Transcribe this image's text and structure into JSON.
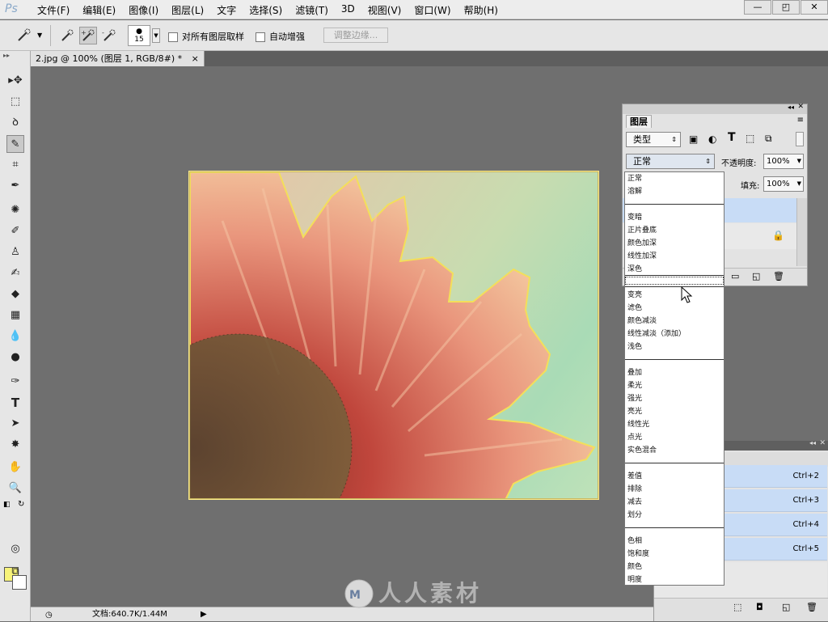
{
  "app": {
    "logo": "Ps",
    "menus": [
      "文件(F)",
      "编辑(E)",
      "图像(I)",
      "图层(L)",
      "文字",
      "选择(S)",
      "滤镜(T)",
      "3D",
      "视图(V)",
      "窗口(W)",
      "帮助(H)"
    ],
    "window_controls": [
      "—",
      "◰",
      "✕"
    ]
  },
  "options": {
    "brush_size": "15",
    "sample_all_label": "对所有图层取样",
    "auto_enhance_label": "自动增强",
    "refine_edge_label": "调整边缘..."
  },
  "document": {
    "tab_title": "2.jpg @ 100% (图层 1, RGB/8#) *",
    "close": "×",
    "status": "文档:640.7K/1.44M"
  },
  "layers_panel": {
    "tab": "图层",
    "filter_kind": "类型",
    "blend_mode": "正常",
    "opacity_label": "不透明度:",
    "opacity_value": "100%",
    "fill_label": "填充:",
    "fill_value": "100%"
  },
  "blend_modes": {
    "group1": [
      "正常",
      "溶解"
    ],
    "group2": [
      "变暗",
      "正片叠底",
      "颜色加深",
      "线性加深",
      "深色"
    ],
    "group3": [
      "变亮",
      "滤色",
      "颜色减淡",
      "线性减淡（添加）",
      "浅色"
    ],
    "group4": [
      "叠加",
      "柔光",
      "强光",
      "亮光",
      "线性光",
      "点光",
      "实色混合"
    ],
    "group5": [
      "差值",
      "排除",
      "减去",
      "划分"
    ],
    "group6": [
      "色相",
      "饱和度",
      "颜色",
      "明度"
    ]
  },
  "channels": {
    "shortcuts": [
      "Ctrl+2",
      "Ctrl+3",
      "Ctrl+4",
      "Ctrl+5"
    ]
  },
  "watermark": "人人素材",
  "colors": {
    "foreground": "#f7f37a",
    "background": "#ffffff",
    "selection": "#c8dcf6"
  }
}
